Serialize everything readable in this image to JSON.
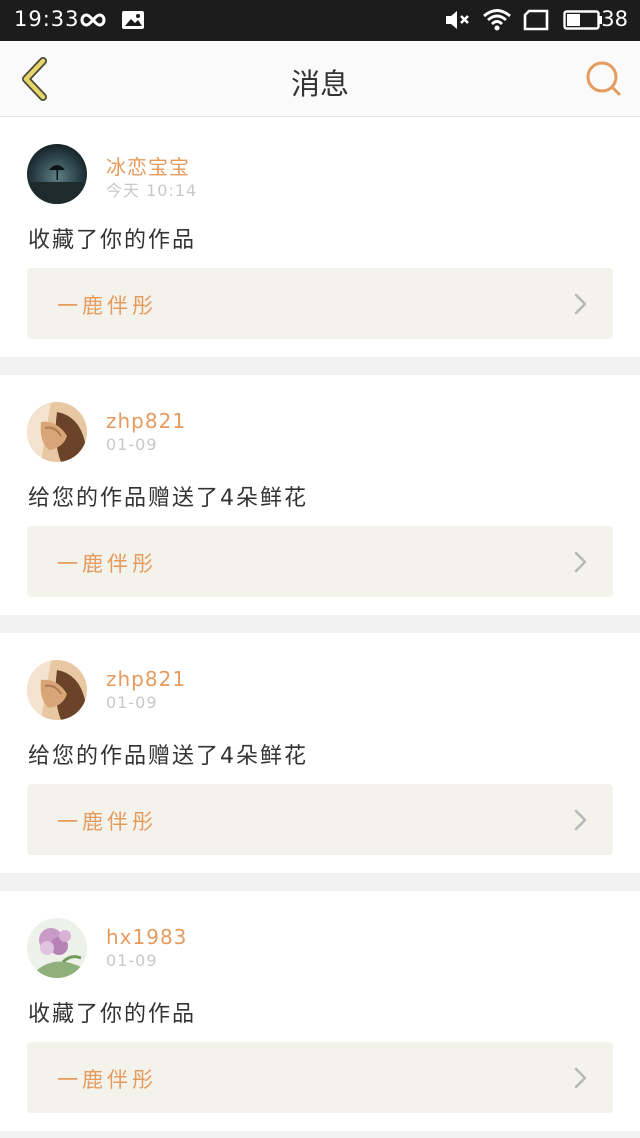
{
  "status_bar": {
    "time": "19:33",
    "battery_level": "38",
    "icons": [
      "infinity-icon",
      "gallery-notification-icon",
      "mute-icon",
      "wifi-icon",
      "screen-icon",
      "battery-icon"
    ]
  },
  "header": {
    "title": "消息",
    "back_icon": "chevron-left-icon",
    "search_icon": "search-icon",
    "accent": "#e69b5e",
    "back_color": "#e8d56a"
  },
  "messages": [
    {
      "username": "冰恋宝宝",
      "time": "今天 10:14",
      "action": "收藏了你的作品",
      "work_title": "一鹿伴彤",
      "avatar": "dark-night-scene-avatar"
    },
    {
      "username": "zhp821",
      "time": "01-09",
      "action": "给您的作品赠送了4朵鲜花",
      "work_title": "一鹿伴彤",
      "avatar": "hands-photo-avatar"
    },
    {
      "username": "zhp821",
      "time": "01-09",
      "action": "给您的作品赠送了4朵鲜花",
      "work_title": "一鹿伴彤",
      "avatar": "hands-photo-avatar"
    },
    {
      "username": "hx1983",
      "time": "01-09",
      "action": "收藏了你的作品",
      "work_title": "一鹿伴彤",
      "avatar": "flowers-avatar"
    }
  ]
}
